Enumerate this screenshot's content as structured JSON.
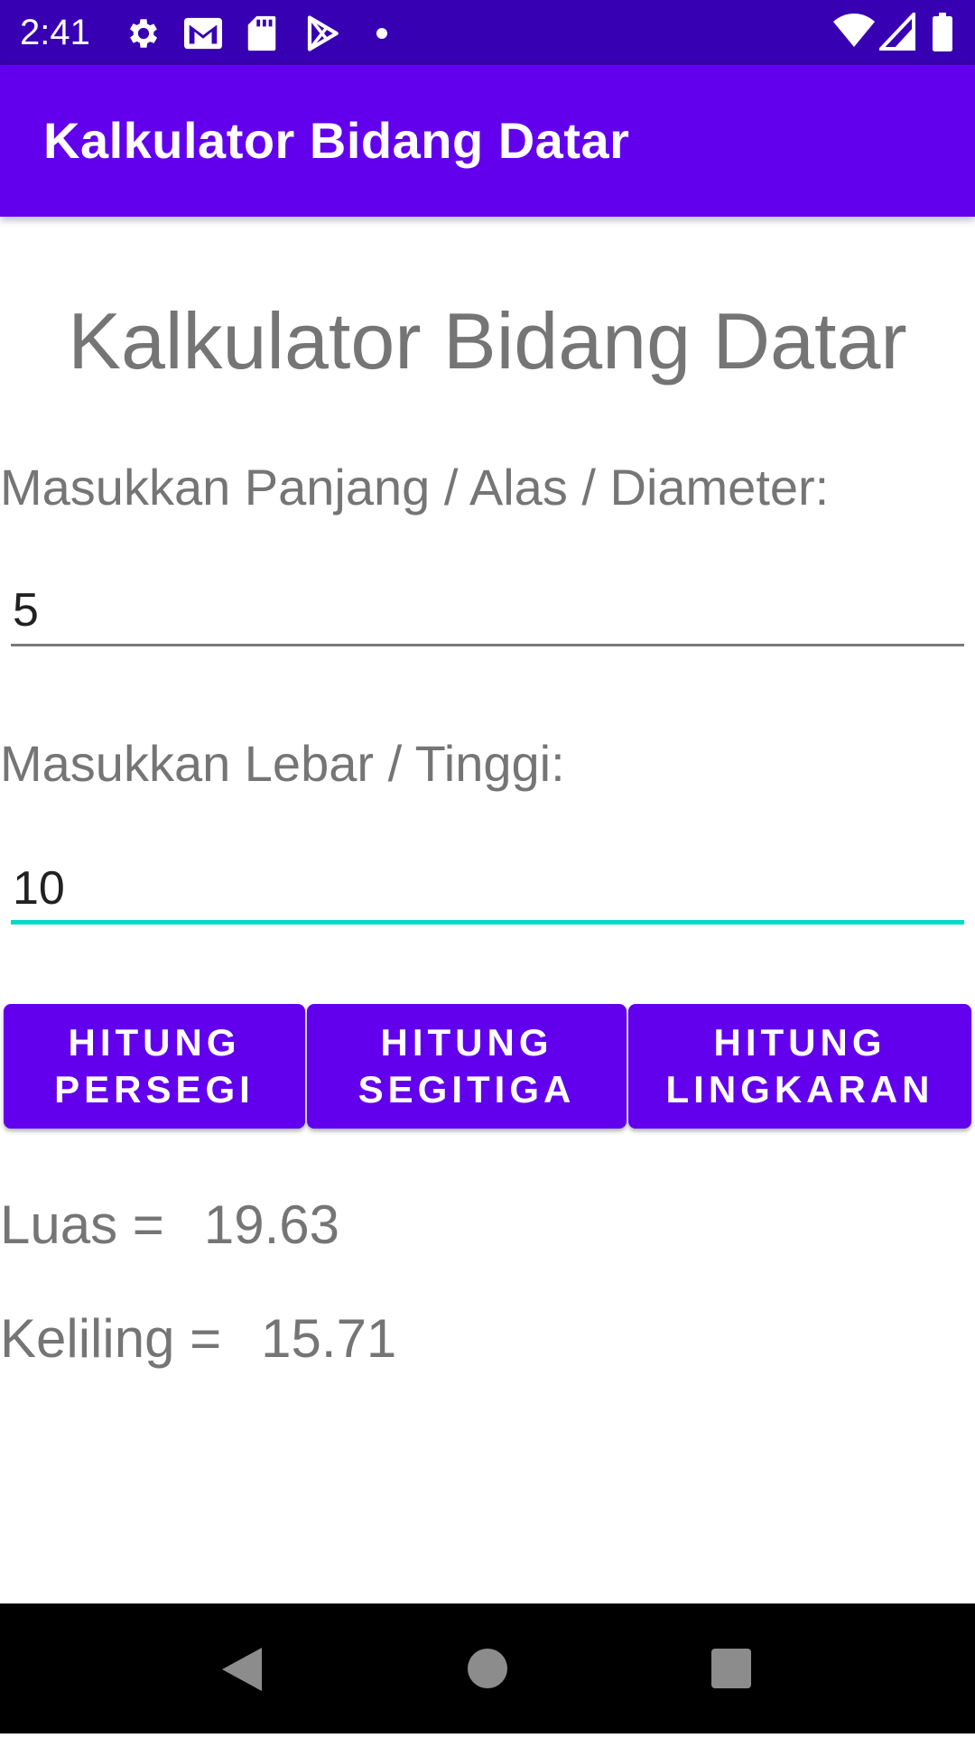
{
  "status_bar": {
    "time": "2:41",
    "left_icons": [
      "gear-icon",
      "gmail-icon",
      "sd-card-icon",
      "play-store-icon",
      "dot-icon"
    ],
    "right_icons": [
      "wifi-icon",
      "signal-icon",
      "battery-icon"
    ]
  },
  "app_bar": {
    "title": "Kalkulator Bidang Datar"
  },
  "main": {
    "heading": "Kalkulator Bidang Datar",
    "field1": {
      "label": "Masukkan Panjang / Alas / Diameter:",
      "value": "5"
    },
    "field2": {
      "label": "Masukkan Lebar / Tinggi:",
      "value": "10"
    },
    "buttons": [
      {
        "line1": "HITUNG",
        "line2": "PERSEGI"
      },
      {
        "line1": "HITUNG",
        "line2": "SEGITIGA"
      },
      {
        "line1": "HITUNG",
        "line2": "LINGKARAN"
      }
    ],
    "results": {
      "luas_label": "Luas =",
      "luas_value": "19.63",
      "keliling_label": "Keliling =",
      "keliling_value": "15.71"
    }
  },
  "nav_bar": {
    "buttons": [
      "back-icon",
      "home-icon",
      "recents-icon"
    ]
  },
  "colors": {
    "status_bar": "#3700b3",
    "primary": "#6200ee",
    "accent": "#03dac5",
    "label_text": "#757575"
  }
}
